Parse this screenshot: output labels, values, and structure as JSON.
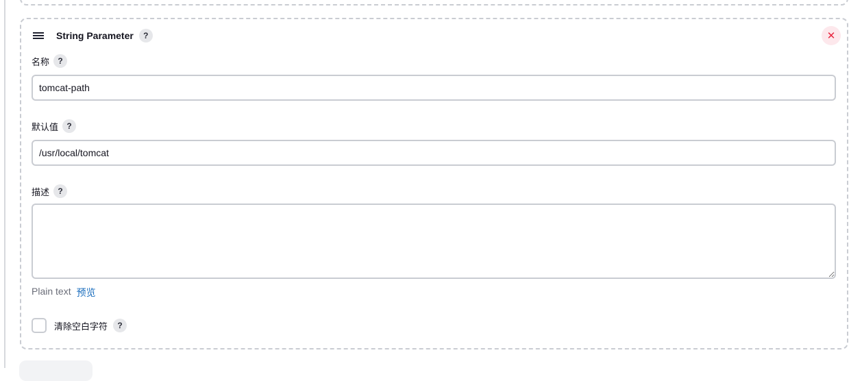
{
  "param_block": {
    "title": "String Parameter",
    "help_glyph": "?",
    "close_glyph": "✕",
    "fields": {
      "name": {
        "label": "名称",
        "value": "tomcat-path"
      },
      "default": {
        "label": "默认值",
        "value": "/usr/local/tomcat"
      },
      "description": {
        "label": "描述",
        "value": ""
      }
    },
    "format": {
      "plain_text": "Plain text",
      "preview_link": "预览"
    },
    "trim": {
      "label": "清除空白字符",
      "checked": false
    }
  },
  "colors": {
    "accent_link": "#1d6fbe",
    "close_red": "#e8253f",
    "border": "#c9ccd2"
  }
}
